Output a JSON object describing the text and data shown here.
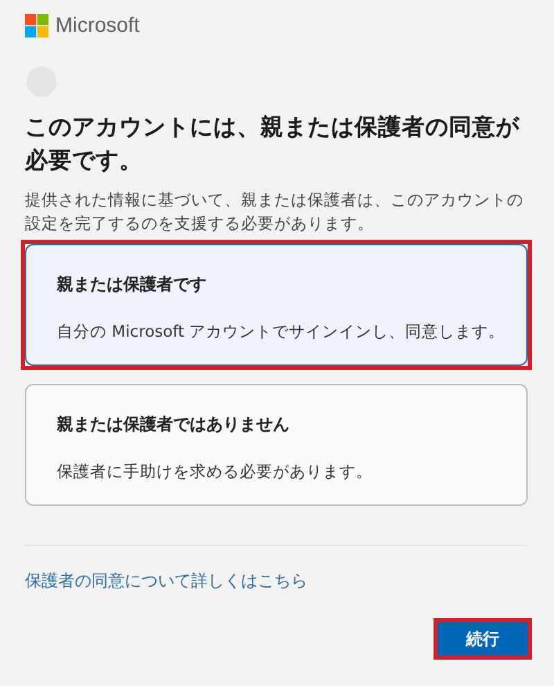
{
  "brand": {
    "name": "Microsoft"
  },
  "heading": "このアカウントには、親または保護者の同意が必要です。",
  "description": "提供された情報に基づいて、親または保護者は、このアカウントの設定を完了するのを支援する必要があります。",
  "options": [
    {
      "title": "親または保護者です",
      "text": "自分の Microsoft アカウントでサインインし、同意します。",
      "selected": true,
      "highlighted": true
    },
    {
      "title": "親または保護者ではありません",
      "text": "保護者に手助けを求める必要があります。",
      "selected": false,
      "highlighted": false
    }
  ],
  "link": "保護者の同意について詳しくはこちら",
  "button": {
    "label": "続行",
    "highlighted": true
  }
}
